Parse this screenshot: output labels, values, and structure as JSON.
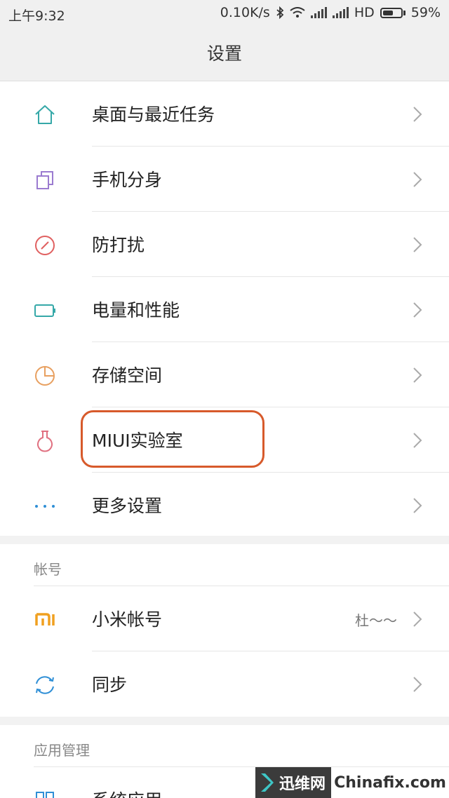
{
  "status_bar": {
    "time": "上午9:32",
    "net_speed": "0.10K/s",
    "network_type": "HD",
    "battery": "59%",
    "battery_level": 0.59
  },
  "header": {
    "title": "设置"
  },
  "colors": {
    "accent_highlight": "#d75a2b",
    "icon_teal": "#35a8a8",
    "icon_purple": "#9b7bd0",
    "icon_red": "#e06060",
    "icon_orange": "#e8a060",
    "icon_pink": "#e07080",
    "icon_blue": "#2f8fd6",
    "mi_orange": "#f0a020"
  },
  "main_items": [
    {
      "label": "桌面与最近任务",
      "icon": "home-icon"
    },
    {
      "label": "手机分身",
      "icon": "clone-icon"
    },
    {
      "label": "防打扰",
      "icon": "do-not-disturb-icon"
    },
    {
      "label": "电量和性能",
      "icon": "battery-icon"
    },
    {
      "label": "存储空间",
      "icon": "storage-pie-icon"
    },
    {
      "label": "MIUI实验室",
      "icon": "flask-icon",
      "highlighted": true
    },
    {
      "label": "更多设置",
      "icon": "more-dots-icon"
    }
  ],
  "account_section": {
    "title": "帐号",
    "items": [
      {
        "label": "小米帐号",
        "value": "杜～～",
        "icon": "mi-logo-icon"
      },
      {
        "label": "同步",
        "icon": "sync-icon"
      }
    ]
  },
  "app_section": {
    "title": "应用管理",
    "items": [
      {
        "label": "系统应用",
        "icon": "apps-grid-icon"
      }
    ]
  },
  "watermark": {
    "left_text": "迅维网",
    "right_text": "Chinafix.com"
  }
}
